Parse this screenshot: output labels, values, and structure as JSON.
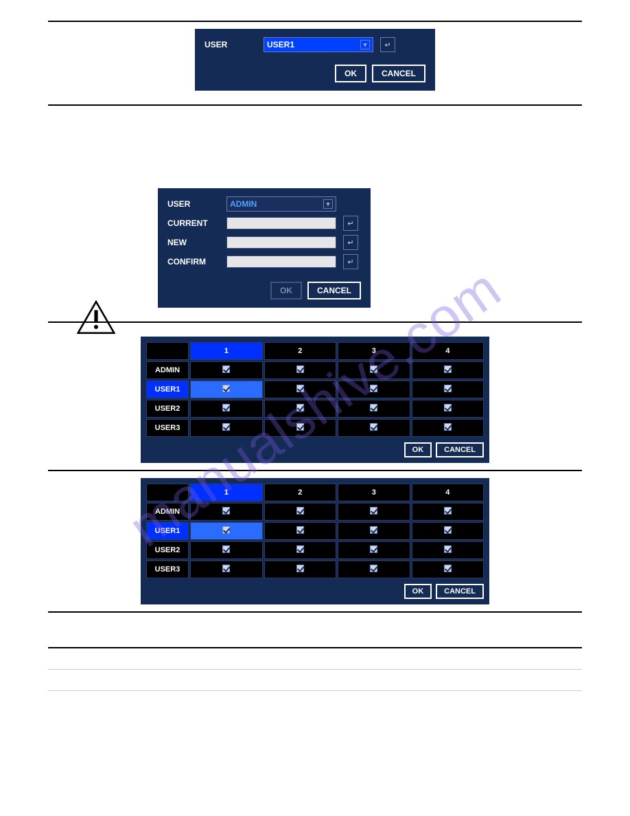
{
  "watermark": "manualshive.com",
  "dialog1": {
    "label_user": "USER",
    "dropdown_value": "USER1",
    "ok": "OK",
    "cancel": "CANCEL"
  },
  "dialog2": {
    "label_user": "USER",
    "dropdown_value": "ADMIN",
    "label_current": "CURRENT",
    "label_new": "NEW",
    "label_confirm": "CONFIRM",
    "ok": "OK",
    "cancel": "CANCEL"
  },
  "perm_table": {
    "cols": [
      "1",
      "2",
      "3",
      "4"
    ],
    "rows": [
      "ADMIN",
      "USER1",
      "USER2",
      "USER3"
    ],
    "ok": "OK",
    "cancel": "CANCEL"
  }
}
